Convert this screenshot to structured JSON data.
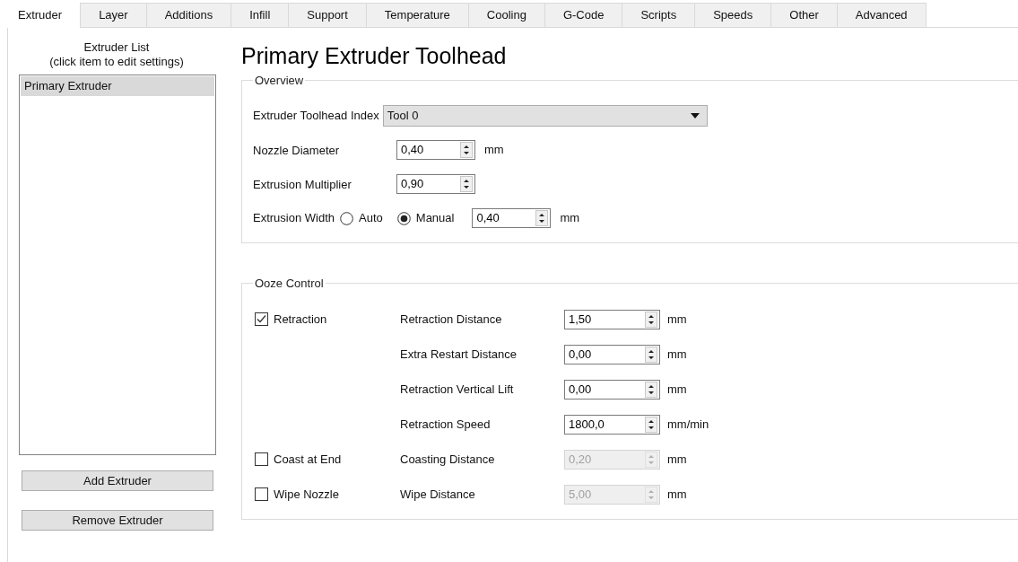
{
  "tabs": [
    {
      "label": "Extruder",
      "selected": true
    },
    {
      "label": "Layer",
      "selected": false
    },
    {
      "label": "Additions",
      "selected": false
    },
    {
      "label": "Infill",
      "selected": false
    },
    {
      "label": "Support",
      "selected": false
    },
    {
      "label": "Temperature",
      "selected": false
    },
    {
      "label": "Cooling",
      "selected": false
    },
    {
      "label": "G-Code",
      "selected": false
    },
    {
      "label": "Scripts",
      "selected": false
    },
    {
      "label": "Speeds",
      "selected": false
    },
    {
      "label": "Other",
      "selected": false
    },
    {
      "label": "Advanced",
      "selected": false
    }
  ],
  "extruder_list": {
    "heading": "Extruder List",
    "subheading": "(click item to edit settings)",
    "items": [
      {
        "label": "Primary Extruder",
        "selected": true
      }
    ],
    "buttons": [
      "Add Extruder",
      "Remove Extruder"
    ]
  },
  "title": "Primary Extruder Toolhead",
  "overview": {
    "title": "Overview",
    "rows": [
      {
        "kind": "select",
        "label": "Extruder Toolhead Index",
        "value": "Tool 0"
      },
      {
        "kind": "spin",
        "label": "Nozzle Diameter",
        "value": "0,40",
        "unit": "mm"
      },
      {
        "kind": "spin",
        "label": "Extrusion Multiplier",
        "value": "0,90"
      },
      {
        "kind": "radio_spin",
        "label": "Extrusion Width",
        "options": [
          {
            "label": "Auto",
            "selected": false
          },
          {
            "label": "Manual",
            "selected": true
          }
        ],
        "value": "0,40",
        "unit": "mm"
      }
    ]
  },
  "ooze_control": {
    "title": "Ooze Control",
    "rows": [
      {
        "checkbox": {
          "label": "Retraction",
          "checked": true
        },
        "label": "Retraction Distance",
        "value": "1,50",
        "unit": "mm",
        "disabled": false
      },
      {
        "label": "Extra Restart Distance",
        "value": "0,00",
        "unit": "mm",
        "disabled": false
      },
      {
        "label": "Retraction Vertical Lift",
        "value": "0,00",
        "unit": "mm",
        "disabled": false
      },
      {
        "label": "Retraction Speed",
        "value": "1800,0",
        "unit": "mm/min",
        "disabled": false
      },
      {
        "checkbox": {
          "label": "Coast at End",
          "checked": false
        },
        "label": "Coasting Distance",
        "value": "0,20",
        "unit": "mm",
        "disabled": true
      },
      {
        "checkbox": {
          "label": "Wipe Nozzle",
          "checked": false
        },
        "label": "Wipe Distance",
        "value": "5,00",
        "unit": "mm",
        "disabled": true
      }
    ]
  }
}
